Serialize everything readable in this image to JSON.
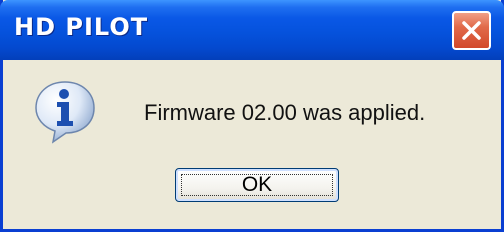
{
  "window": {
    "title": "HD PILOT",
    "close_icon": "close-icon",
    "title_bar_color": "#0552dc",
    "close_button_color": "#d2482a"
  },
  "dialog": {
    "icon": "info-icon",
    "message": "Firmware 02.00 was applied.",
    "ok_label": "OK"
  }
}
